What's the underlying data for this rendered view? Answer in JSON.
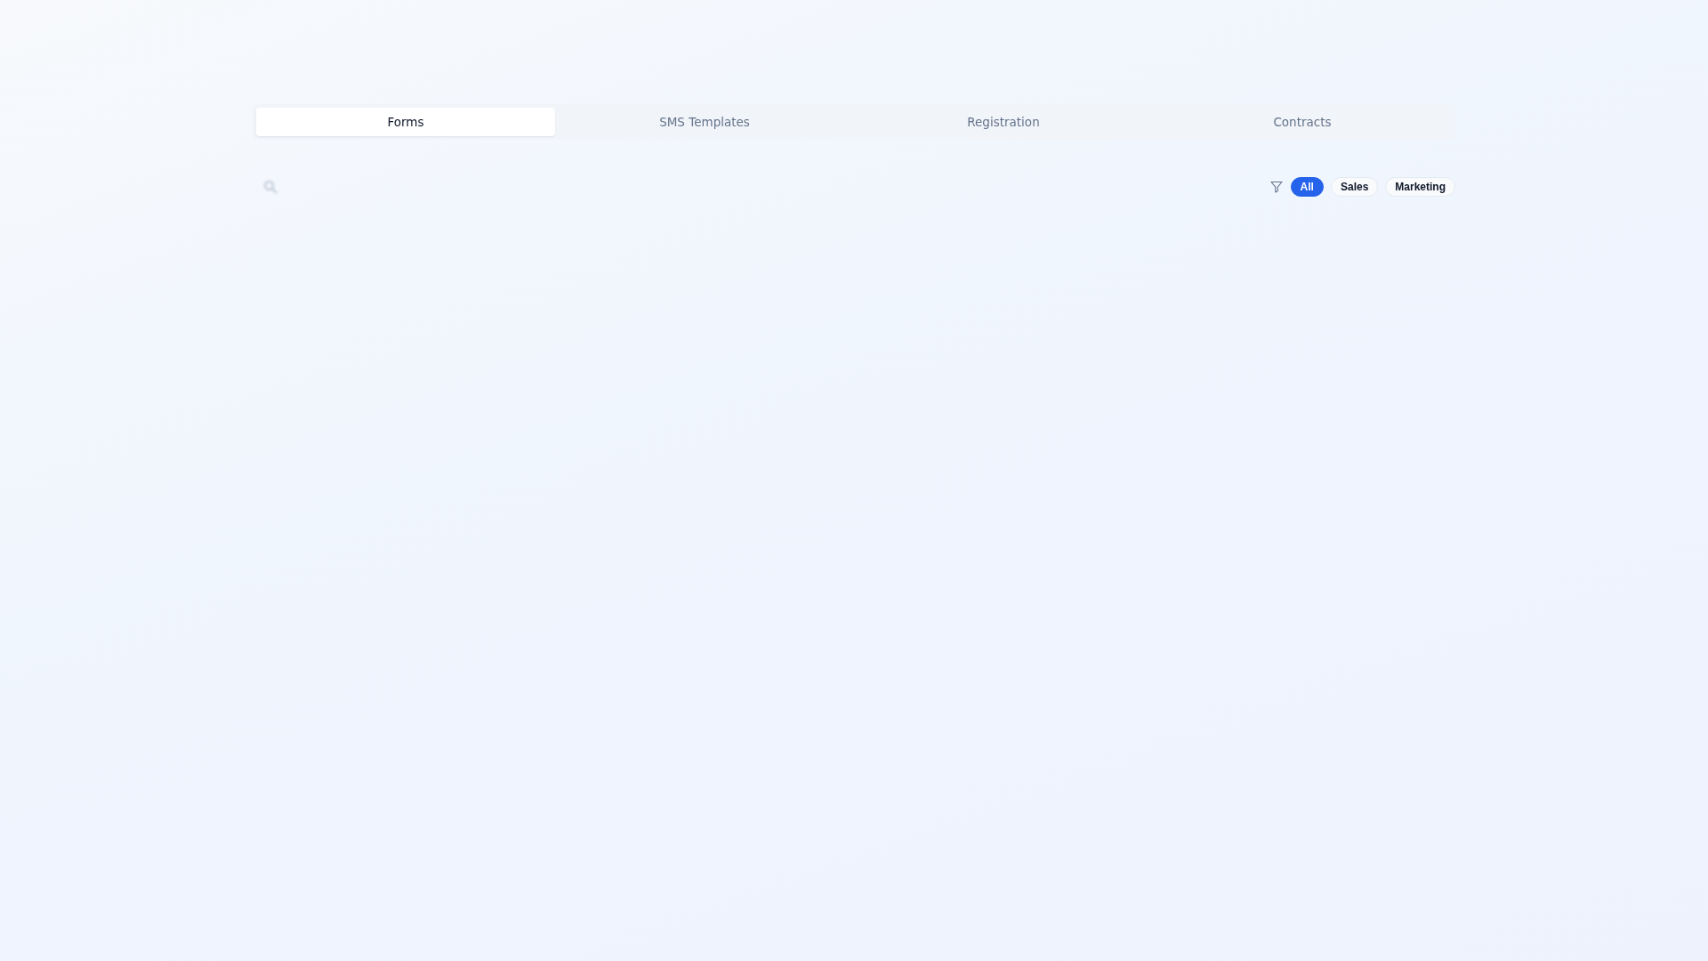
{
  "tabs": [
    {
      "label": "Forms",
      "selected": true
    },
    {
      "label": "SMS Templates",
      "selected": false
    },
    {
      "label": "Registration",
      "selected": false
    },
    {
      "label": "Contracts",
      "selected": false
    }
  ],
  "filters": [
    {
      "label": "All",
      "selected": true
    },
    {
      "label": "Sales",
      "selected": false
    },
    {
      "label": "Marketing",
      "selected": false
    }
  ]
}
